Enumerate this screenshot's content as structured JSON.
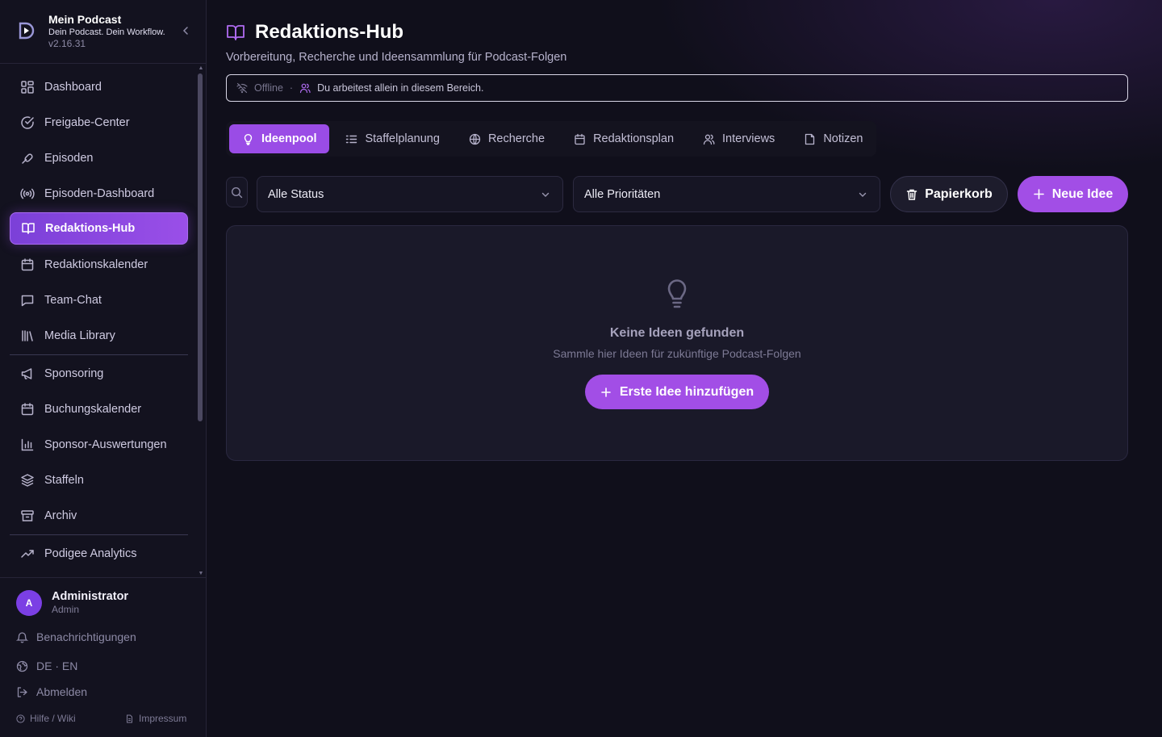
{
  "brand": {
    "title": "Mein Podcast",
    "subtitle": "Dein Podcast. Dein Workflow.",
    "version": "v2.16.31"
  },
  "sidebar": {
    "items": [
      {
        "label": "Dashboard",
        "icon": "dashboard-icon"
      },
      {
        "label": "Freigabe-Center",
        "icon": "check-circle-icon"
      },
      {
        "label": "Episoden",
        "icon": "link-icon"
      },
      {
        "label": "Episoden-Dashboard",
        "icon": "broadcast-icon"
      },
      {
        "label": "Redaktions-Hub",
        "icon": "book-open-icon",
        "active": true
      },
      {
        "label": "Redaktionskalender",
        "icon": "calendar-icon"
      },
      {
        "label": "Team-Chat",
        "icon": "chat-icon"
      },
      {
        "label": "Media Library",
        "icon": "library-icon"
      },
      {
        "label": "Sponsoring",
        "icon": "megaphone-icon"
      },
      {
        "label": "Buchungskalender",
        "icon": "calendar-icon"
      },
      {
        "label": "Sponsor-Auswertungen",
        "icon": "bar-chart-icon"
      },
      {
        "label": "Staffeln",
        "icon": "layers-icon"
      },
      {
        "label": "Archiv",
        "icon": "archive-icon"
      },
      {
        "label": "Podigee Analytics",
        "icon": "trending-up-icon"
      }
    ]
  },
  "user": {
    "initial": "A",
    "name": "Administrator",
    "role": "Admin"
  },
  "footer": {
    "notifications": "Benachrichtigungen",
    "language": "DE · EN",
    "logout": "Abmelden",
    "help": "Hilfe / Wiki",
    "imprint": "Impressum"
  },
  "page": {
    "title": "Redaktions-Hub",
    "subtitle": "Vorbereitung, Recherche und Ideensammlung für Podcast-Folgen"
  },
  "status": {
    "offline": "Offline",
    "separator": "·",
    "message": "Du arbeitest allein in diesem Bereich."
  },
  "tabs": [
    {
      "label": "Ideenpool",
      "icon": "lightbulb-icon",
      "active": true
    },
    {
      "label": "Staffelplanung",
      "icon": "list-ordered-icon"
    },
    {
      "label": "Recherche",
      "icon": "globe-icon"
    },
    {
      "label": "Redaktionsplan",
      "icon": "calendar-icon"
    },
    {
      "label": "Interviews",
      "icon": "users-icon"
    },
    {
      "label": "Notizen",
      "icon": "sticky-note-icon"
    }
  ],
  "filters": {
    "status_value": "Alle Status",
    "priority_value": "Alle Prioritäten",
    "trash_label": "Papierkorb",
    "new_label": "Neue Idee"
  },
  "empty": {
    "title": "Keine Ideen gefunden",
    "subtitle": "Sammle hier Ideen für zukünftige Podcast-Folgen",
    "button_label": "Erste Idee hinzufügen"
  },
  "colors": {
    "accent": "#a24ee6",
    "sidebar_bg": "#13121f",
    "main_bg": "#100f1b",
    "card_bg": "#1a1929"
  }
}
